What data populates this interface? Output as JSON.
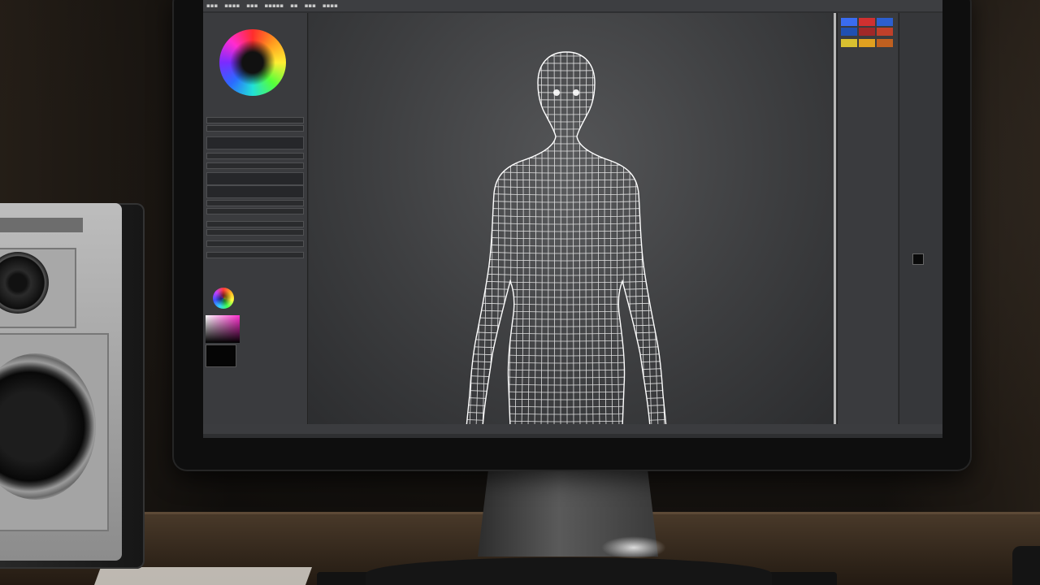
{
  "scene": {
    "description_free": true,
    "screen_color": "#2e2f31",
    "viewport_color": "#4a4b4d",
    "accent_colors": [
      "#ff2d2d",
      "#ffee33",
      "#2a6bff",
      "#ff2bd1"
    ]
  },
  "menubar": {
    "items": []
  },
  "left_panel": {
    "head": ""
  },
  "status_bar": {
    "text": ""
  },
  "icons": {
    "color_wheel": "color-wheel-icon",
    "mini_wheel": "color-wheel-icon",
    "wireframe": "wireframe-figure"
  }
}
